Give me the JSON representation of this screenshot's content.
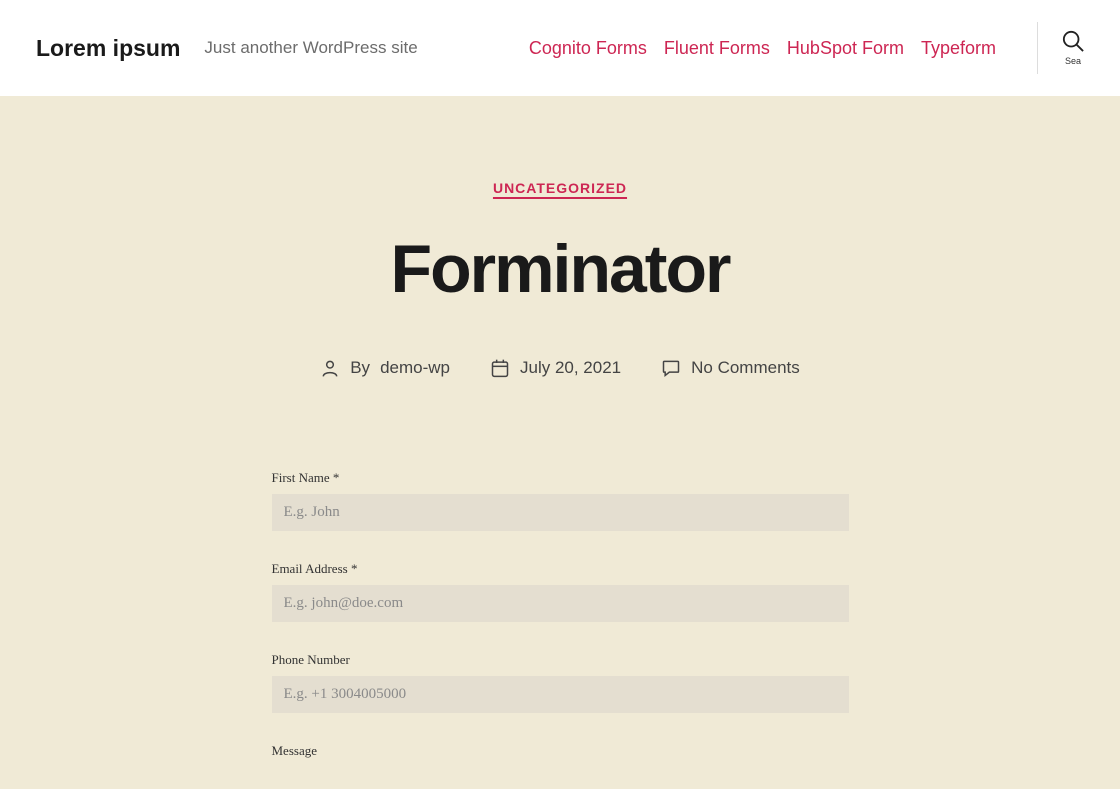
{
  "header": {
    "siteTitle": "Lorem ipsum",
    "tagline": "Just another WordPress site",
    "navLinks": [
      "Cognito Forms",
      "Fluent Forms",
      "HubSpot Form",
      "Typeform"
    ],
    "searchLabel": "Sea"
  },
  "post": {
    "categoryLabel": "UNCATEGORIZED",
    "title": "Forminator",
    "byLabel": "By",
    "author": "demo-wp",
    "date": "July 20, 2021",
    "commentsLabel": "No Comments"
  },
  "form": {
    "firstName": {
      "label": "First Name",
      "required": "*",
      "placeholder": "E.g. John"
    },
    "email": {
      "label": "Email Address",
      "required": "*",
      "placeholder": "E.g. john@doe.com"
    },
    "phone": {
      "label": "Phone Number",
      "placeholder": "E.g. +1 3004005000"
    },
    "message": {
      "label": "Message"
    }
  }
}
